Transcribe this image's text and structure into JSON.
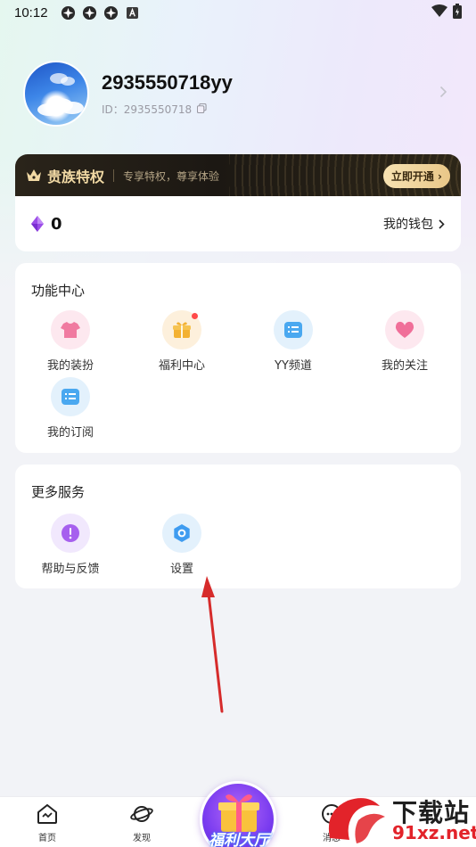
{
  "status_bar": {
    "time": "10:12"
  },
  "profile": {
    "username": "2935550718yy",
    "id_label": "ID：2935550718"
  },
  "vip": {
    "title": "贵族特权",
    "subtitle": "专享特权，尊享体验",
    "button": "立即开通"
  },
  "wallet": {
    "amount": "0",
    "link": "我的钱包"
  },
  "function_center": {
    "title": "功能中心",
    "items": [
      {
        "label": "我的装扮",
        "icon": "shirt-icon"
      },
      {
        "label": "福利中心",
        "icon": "gift-icon",
        "badge": true
      },
      {
        "label": "YY频道",
        "icon": "channel-icon"
      },
      {
        "label": "我的关注",
        "icon": "heart-icon"
      },
      {
        "label": "我的订阅",
        "icon": "subscribe-icon"
      }
    ]
  },
  "more_services": {
    "title": "更多服务",
    "items": [
      {
        "label": "帮助与反馈",
        "icon": "help-icon"
      },
      {
        "label": "设置",
        "icon": "settings-icon"
      }
    ]
  },
  "bottom_nav": {
    "items": [
      {
        "label": "首页",
        "icon": "home-icon"
      },
      {
        "label": "发现",
        "icon": "discover-icon"
      },
      {
        "label": "消息",
        "icon": "message-icon"
      }
    ],
    "center_label": "福利大厅"
  },
  "watermark": {
    "line1": "下载站",
    "line2": "91xz.net"
  },
  "colors": {
    "vip_gold": "#f1d9a4",
    "accent_purple": "#7a3cf0",
    "badge_red": "#ff4a4a",
    "annotation_arrow": "#d62b2b"
  }
}
